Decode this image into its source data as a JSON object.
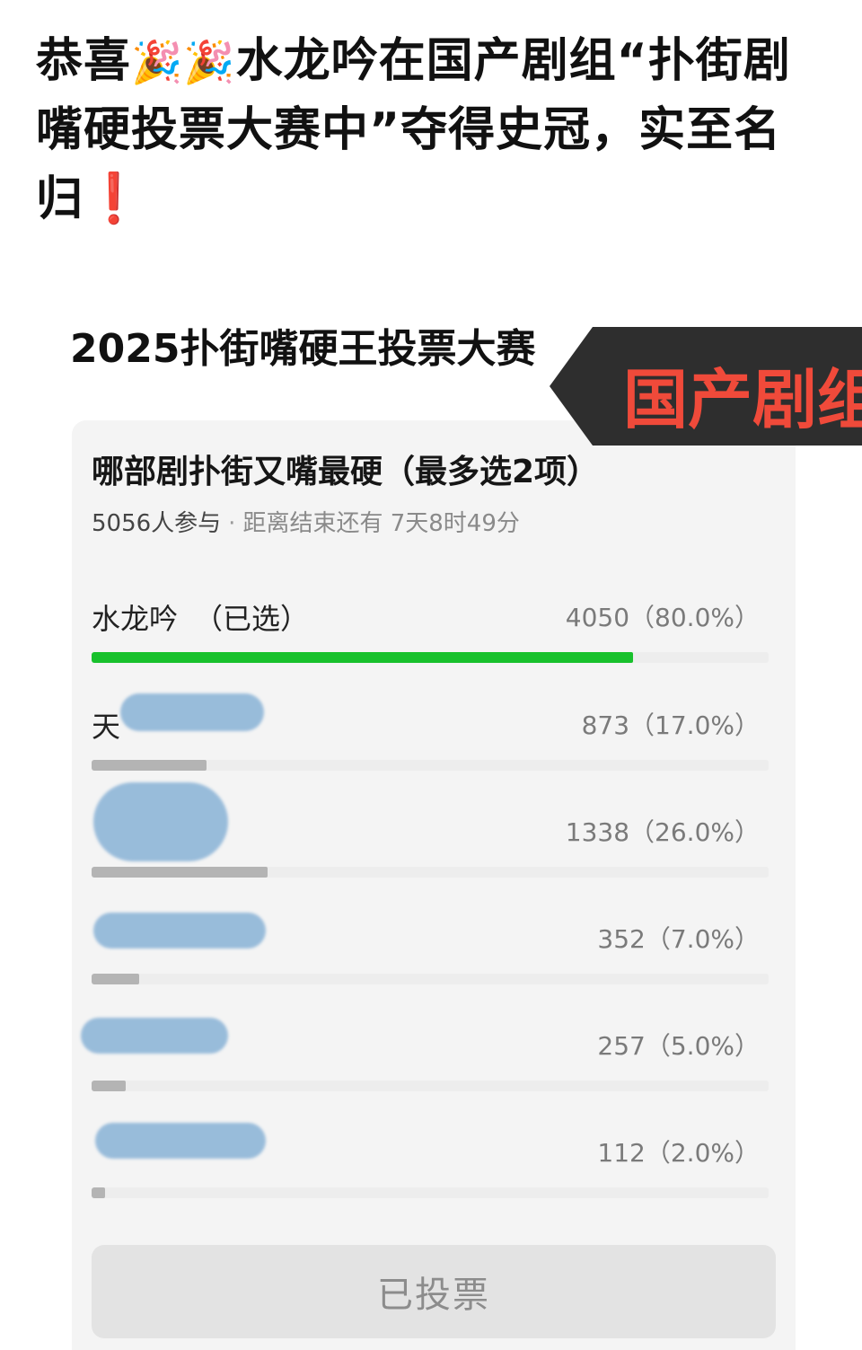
{
  "headline": {
    "line_before": "恭喜",
    "emoji": "🎉🎉",
    "line_after": "水龙吟在国产剧组“扑街剧嘴硬投票大赛中”夺得史冠，实至名归",
    "exclaim": "❗"
  },
  "poll_page_title": "2025扑街嘴硬王投票大赛",
  "tag_label": "国产剧组",
  "poll": {
    "question": "哪部剧扑街又嘴最硬（最多选2项）",
    "participants": "5056人参与",
    "separator": "·",
    "time_remaining": "距离结束还有 7天8时49分",
    "options": [
      {
        "label": "水龙吟",
        "selected_mark": "（已选）",
        "count": "4050（80.0%）",
        "fraction": 0.8,
        "color": "#18c12c"
      },
      {
        "label": "天",
        "count": "873（17.0%）",
        "fraction": 0.17,
        "color": "#b4b4b4"
      },
      {
        "label": "",
        "count": "1338（26.0%）",
        "fraction": 0.26,
        "color": "#b4b4b4"
      },
      {
        "label": "",
        "count": "352（7.0%）",
        "fraction": 0.07,
        "color": "#b4b4b4"
      },
      {
        "label": "",
        "count": "257（5.0%）",
        "fraction": 0.05,
        "color": "#b4b4b4"
      },
      {
        "label": "",
        "count": "112（2.0%）",
        "fraction": 0.02,
        "color": "#b4b4b4"
      }
    ],
    "vote_button": "已投票"
  }
}
